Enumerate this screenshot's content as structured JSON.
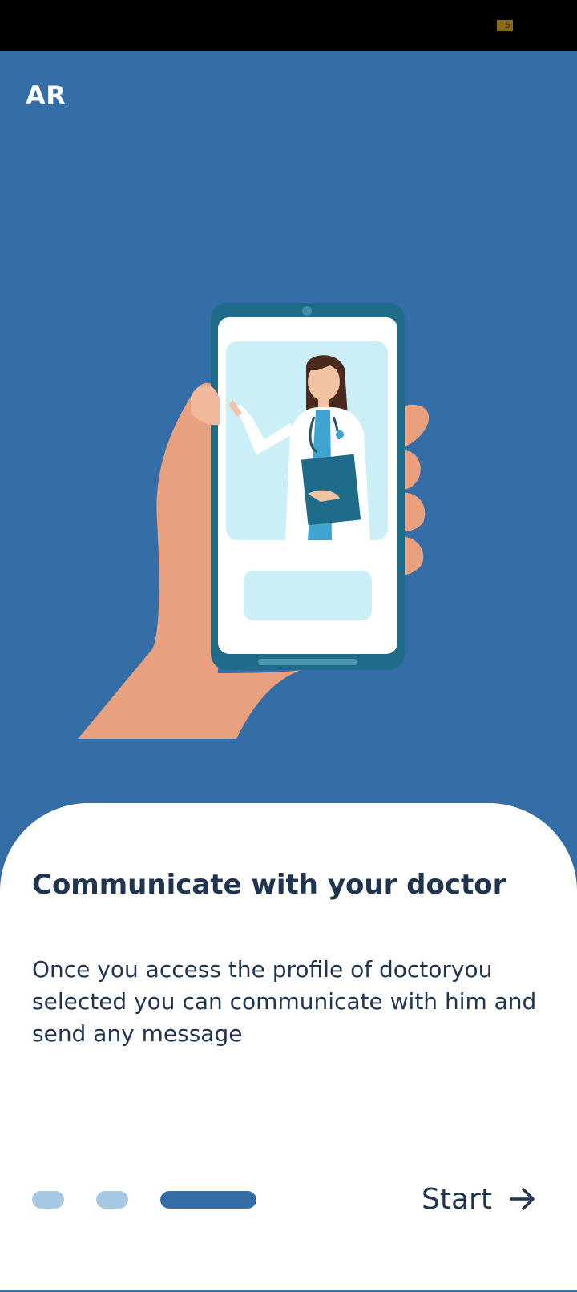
{
  "status_bar": {
    "badge": "5",
    "background": "#000000"
  },
  "header": {
    "language_toggle": "AR"
  },
  "illustration": {
    "icon": "doctor-on-phone-illustration"
  },
  "onboarding": {
    "title": "Communicate with your doctor",
    "description": "Once you access the profile of doctoryou selected you can communicate with him and send any message",
    "pages_total": 3,
    "current_page": 3,
    "start_label": "Start",
    "start_icon": "arrow-right-icon"
  },
  "colors": {
    "primary": "#356EA6",
    "text": "#1F344F",
    "indicator_inactive": "#A6CAE4",
    "sheet": "#FFFFFF"
  }
}
